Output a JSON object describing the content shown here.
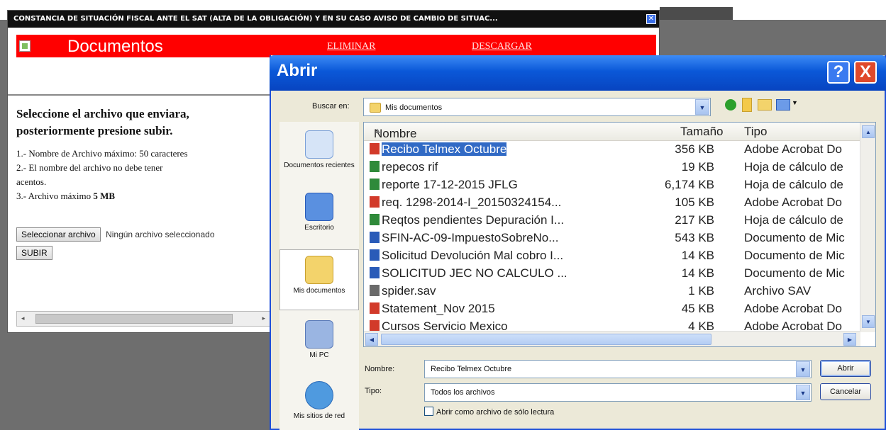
{
  "popup": {
    "title": "CONSTANCIA DE SITUACIÓN FISCAL ANTE EL SAT (ALTA DE LA OBLIGACIÓN) Y EN SU CASO AVISO DE CAMBIO DE SITUAC...",
    "header_title": "Documentos",
    "links": [
      "ELIMINAR",
      "DESCARGAR"
    ],
    "instructions_title_1": "Seleccione el archivo que enviara,",
    "instructions_title_2": "posteriormente presione subir.",
    "rules": [
      "1.- Nombre de Archivo máximo: 50 caracteres",
      "2.- El nombre del archivo no debe tener",
      "acentos.",
      "3.- Archivo máximo ",
      "5 MB"
    ],
    "select_button": "Seleccionar archivo",
    "no_file_text": "Ningún archivo seleccionado",
    "upload_button": "SUBIR"
  },
  "dialog": {
    "title": "Abrir",
    "help": "?",
    "close": "X",
    "look_in_label": "Buscar en:",
    "look_in_value": "Mis documentos",
    "places": [
      "Documentos recientes",
      "Escritorio",
      "Mis documentos",
      "Mi PC",
      "Mis sitios de red"
    ],
    "columns": {
      "name": "Nombre",
      "size": "Tamaño",
      "type": "Tipo"
    },
    "files": [
      {
        "name": "Recibo Telmex Octubre",
        "size": "356 KB",
        "type": "Adobe Acrobat Do",
        "icon": "pdf-icon"
      },
      {
        "name": "repecos rif",
        "size": "19 KB",
        "type": "Hoja de cálculo de",
        "icon": "excel-icon"
      },
      {
        "name": "reporte 17-12-2015 JFLG",
        "size": "6,174 KB",
        "type": "Hoja de cálculo de",
        "icon": "excel-icon"
      },
      {
        "name": "req. 1298-2014-I_20150324154...",
        "size": "105 KB",
        "type": "Adobe Acrobat Do",
        "icon": "pdf-icon"
      },
      {
        "name": "Reqtos pendientes Depuración I...",
        "size": "217 KB",
        "type": "Hoja de cálculo de",
        "icon": "excel-icon"
      },
      {
        "name": "SFIN-AC-09-ImpuestoSobreNo...",
        "size": "543 KB",
        "type": "Documento de Mic",
        "icon": "word-icon"
      },
      {
        "name": "Solicitud Devolución Mal cobro I...",
        "size": "14 KB",
        "type": "Documento de Mic",
        "icon": "word-icon"
      },
      {
        "name": "SOLICITUD JEC NO CALCULO ...",
        "size": "14 KB",
        "type": "Documento de Mic",
        "icon": "word-icon"
      },
      {
        "name": "spider.sav",
        "size": "1 KB",
        "type": "Archivo SAV",
        "icon": "file-icon"
      },
      {
        "name": "Statement_Nov 2015",
        "size": "45 KB",
        "type": "Adobe Acrobat Do",
        "icon": "pdf-icon"
      },
      {
        "name": "Cursos Servicio Mexico",
        "size": "4 KB",
        "type": "Adobe Acrobat Do",
        "icon": "pdf-icon"
      }
    ],
    "selected_index": 0,
    "filename_label": "Nombre:",
    "filename_value": "Recibo Telmex Octubre",
    "filetype_label": "Tipo:",
    "filetype_value": "Todos los archivos",
    "readonly_label": "Abrir como archivo de sólo lectura",
    "open_button": "Abrir",
    "cancel_button": "Cancelar"
  },
  "colors": {
    "red_bar": "#ff0000",
    "title_blue": "#0a58d8",
    "selection": "#316ac5"
  }
}
